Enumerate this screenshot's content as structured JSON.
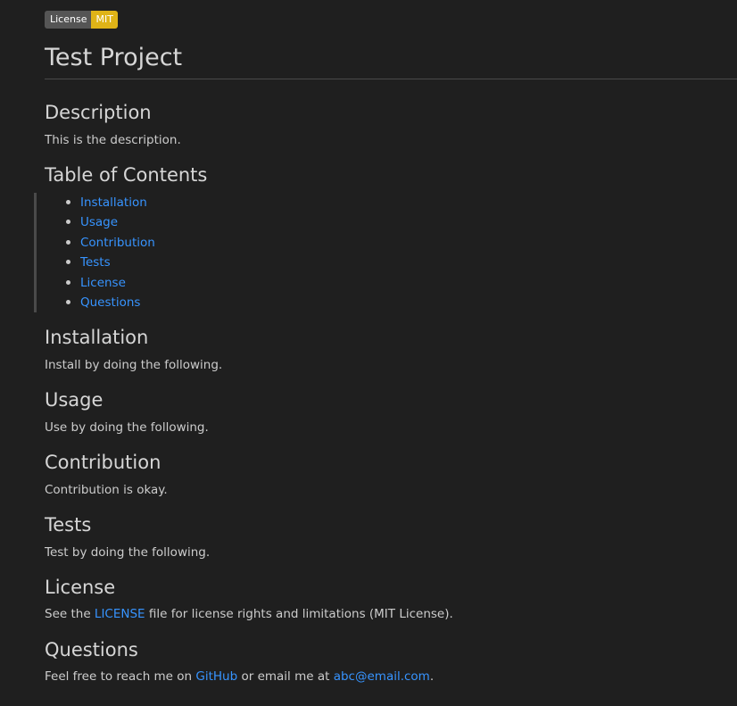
{
  "badge": {
    "left": "License",
    "right": "MIT"
  },
  "title": "Test Project",
  "sections": {
    "description": {
      "heading": "Description",
      "text": "This is the description."
    },
    "toc": {
      "heading": "Table of Contents",
      "items": [
        "Installation",
        "Usage",
        "Contribution",
        "Tests",
        "License",
        "Questions"
      ]
    },
    "installation": {
      "heading": "Installation",
      "text": "Install by doing the following."
    },
    "usage": {
      "heading": "Usage",
      "text": "Use by doing the following."
    },
    "contribution": {
      "heading": "Contribution",
      "text": "Contribution is okay."
    },
    "tests": {
      "heading": "Tests",
      "text": "Test by doing the following."
    },
    "license": {
      "heading": "License",
      "text_before": "See the ",
      "link": "LICENSE",
      "text_after": " file for license rights and limitations (MIT License)."
    },
    "questions": {
      "heading": "Questions",
      "text_before": "Feel free to reach me on ",
      "github_link": "GitHub",
      "text_middle": " or email me at ",
      "email_link": "abc@email.com",
      "text_after": "."
    }
  },
  "colors": {
    "background": "#1f1f1f",
    "text": "#cccccc",
    "link": "#3794ff",
    "badge_left": "#555555",
    "badge_right": "#dfb317"
  }
}
